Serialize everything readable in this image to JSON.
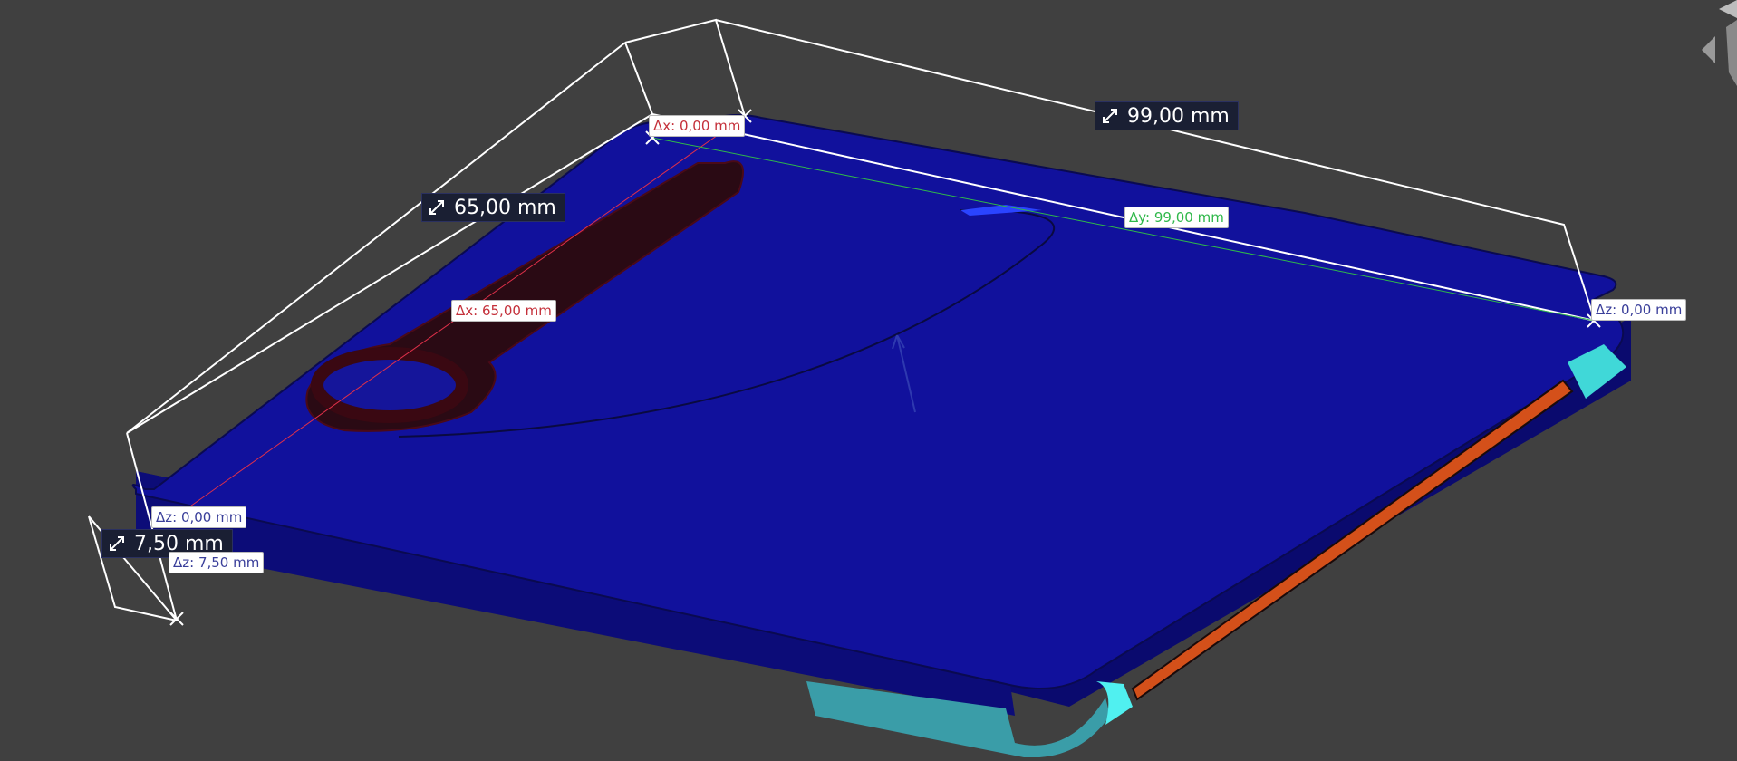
{
  "measurements": {
    "length_y": "99,00 mm",
    "length_x": "65,00 mm",
    "length_z": "7,50 mm"
  },
  "deltas": {
    "dx_top": "Δx: 0,00 mm",
    "dx_mid": "Δx: 65,00 mm",
    "dy": "Δy: 99,00 mm",
    "dz_right": "Δz: 0,00 mm",
    "dz_left": "Δz: 0,00 mm",
    "dz_height": "Δz: 7,50 mm"
  },
  "colors": {
    "background": "#404040",
    "body_top": "#11119c",
    "body_side": "#0a0a6e",
    "slot": "#2a0a14",
    "accent_cyan": "#40e8e8",
    "accent_orange": "#d4501a",
    "x_axis": "#e0304a",
    "y_axis": "#2fb84a"
  },
  "nav_cube": {
    "icon": "nav-cube-icon"
  }
}
